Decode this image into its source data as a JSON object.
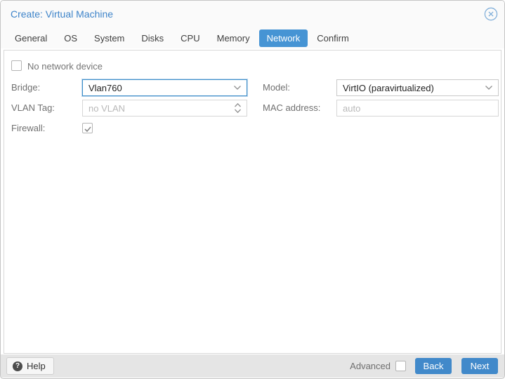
{
  "colors": {
    "accent": "#4694d4",
    "title": "#3e84c9",
    "button": "#4189ca",
    "footer-bg": "#e5e5e5",
    "label": "#707070",
    "value": "#222222",
    "placeholder": "#b8b8b8",
    "border": "#c9c9c9",
    "focus": "#3d8ec9"
  },
  "window": {
    "title": "Create: Virtual Machine",
    "close_icon": "circle-x"
  },
  "tabs": [
    {
      "label": "General",
      "active": false
    },
    {
      "label": "OS",
      "active": false
    },
    {
      "label": "System",
      "active": false
    },
    {
      "label": "Disks",
      "active": false
    },
    {
      "label": "CPU",
      "active": false
    },
    {
      "label": "Memory",
      "active": false
    },
    {
      "label": "Network",
      "active": true
    },
    {
      "label": "Confirm",
      "active": false
    }
  ],
  "form": {
    "no_network_device": {
      "label": "No network device",
      "checked": false
    },
    "bridge": {
      "label": "Bridge:",
      "value": "Vlan760",
      "focused": true,
      "control": "dropdown"
    },
    "vlan_tag": {
      "label": "VLAN Tag:",
      "placeholder": "no VLAN",
      "control": "number-spinner"
    },
    "firewall": {
      "label": "Firewall:",
      "checked": true
    },
    "model": {
      "label": "Model:",
      "value": "VirtIO (paravirtualized)",
      "control": "dropdown"
    },
    "mac_address": {
      "label": "MAC address:",
      "placeholder": "auto",
      "control": "text"
    }
  },
  "footer": {
    "help": "Help",
    "advanced": {
      "label": "Advanced",
      "checked": false
    },
    "back": "Back",
    "next": "Next"
  },
  "icons": {
    "close": "circle-x-icon",
    "help": "question-circle-icon",
    "dropdown": "chevron-down-icon",
    "spinner": "chevron-up-down-icon",
    "check": "checkmark-icon"
  }
}
